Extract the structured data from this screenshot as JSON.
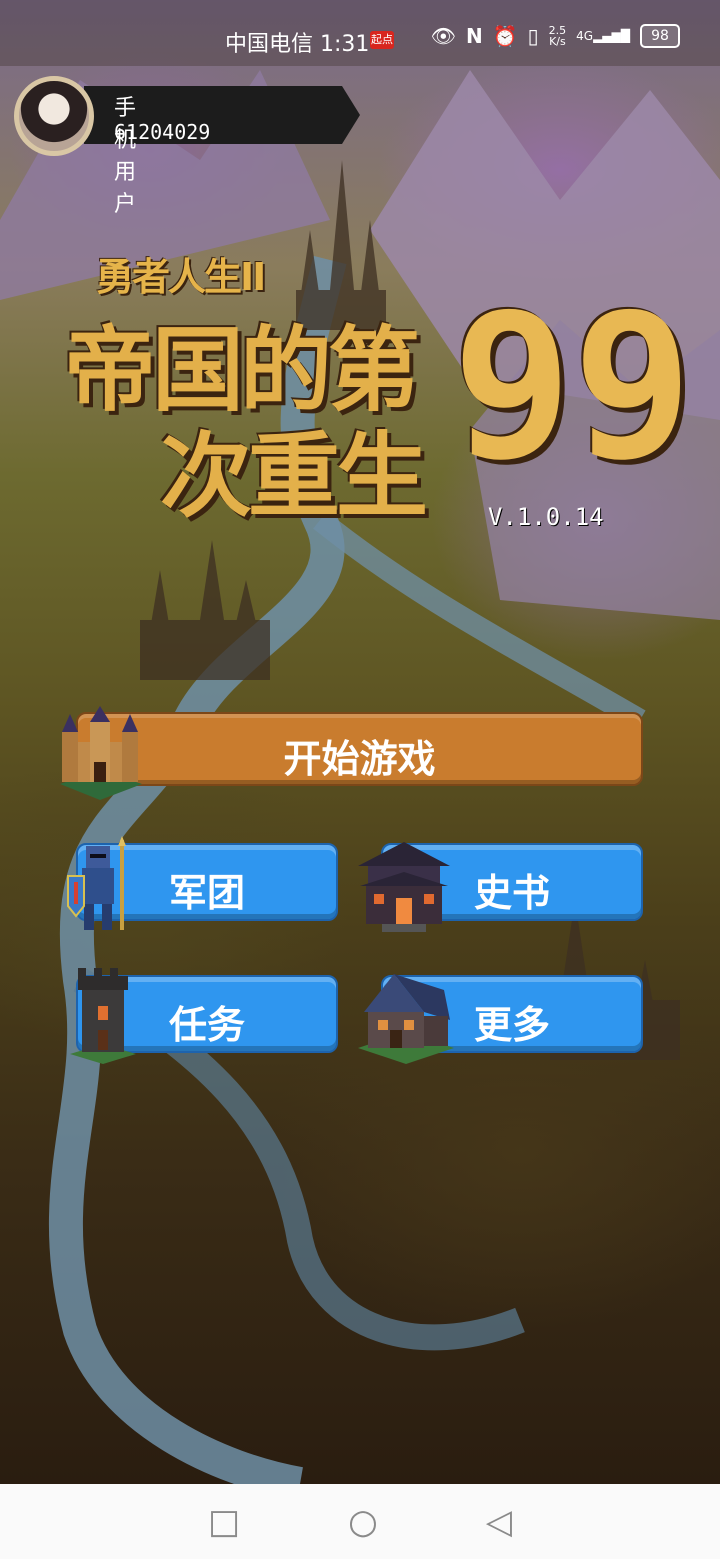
{
  "status_bar": {
    "carrier_time": "中国电信 1:31",
    "badge": "起点",
    "net_speed_top": "2.5",
    "net_speed_bottom": "K/s",
    "network": "4G",
    "battery": "98"
  },
  "user": {
    "name": "手机用户",
    "id": "61204029"
  },
  "logo": {
    "subtitle": "勇者人生II",
    "line1": "帝国的第",
    "line2": "次重生",
    "number": "99"
  },
  "version": "V.1.0.14",
  "menu": {
    "start_game": "开始游戏",
    "legion": "军团",
    "history": "史书",
    "quests": "任务",
    "more": "更多"
  }
}
